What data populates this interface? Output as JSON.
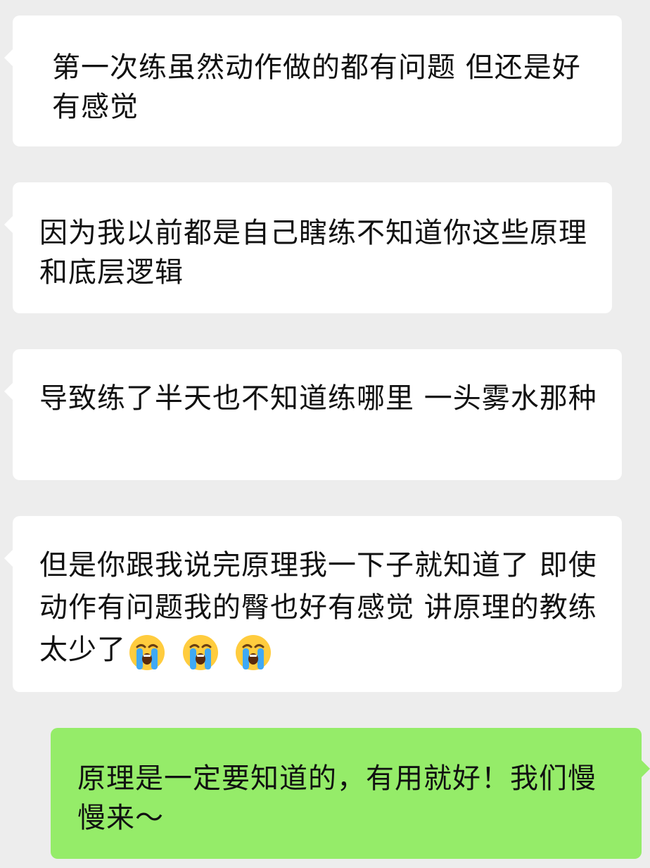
{
  "messages": [
    {
      "side": "incoming",
      "text": "第一次练虽然动作做的都有问题 但还是好有感觉"
    },
    {
      "side": "incoming",
      "text": "因为我以前都是自己瞎练不知道你这些原理和底层逻辑"
    },
    {
      "side": "incoming",
      "text": "导致练了半天也不知道练哪里 一头雾水那种"
    },
    {
      "side": "incoming",
      "text": "但是你跟我说完原理我一下子就知道了 即使动作有问题我的臀也好有感觉 讲原理的教练太少了",
      "emoji": "loudly-crying-face-icon",
      "emoji_count": 3
    },
    {
      "side": "outgoing",
      "text": "原理是一定要知道的，有用就好！我们慢慢来～"
    }
  ],
  "colors": {
    "background": "#ededed",
    "incoming_bubble": "#ffffff",
    "outgoing_bubble": "#95ec69",
    "text": "#111111"
  }
}
